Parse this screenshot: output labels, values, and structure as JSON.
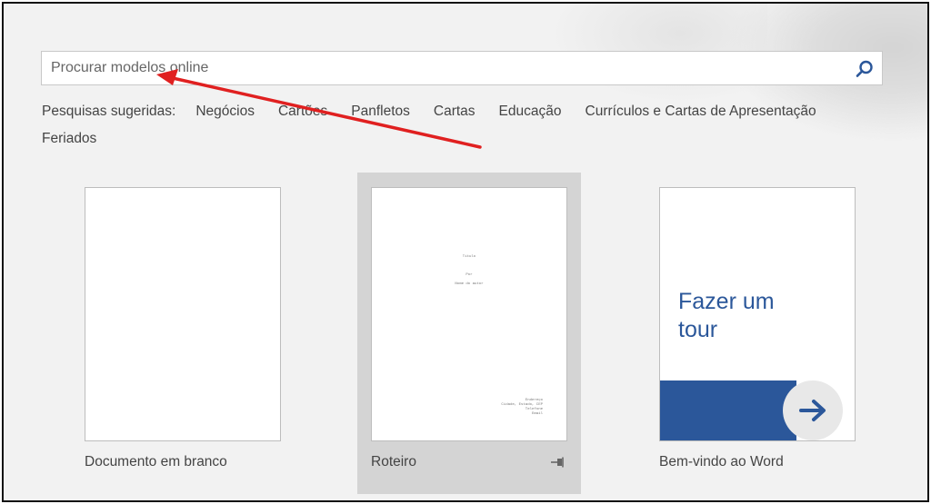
{
  "search": {
    "placeholder": "Procurar modelos online"
  },
  "suggestions": {
    "label": "Pesquisas sugeridas:",
    "items": [
      "Negócios",
      "Cartões",
      "Panfletos",
      "Cartas",
      "Educação",
      "Currículos e Cartas de Apresentação",
      "Feriados"
    ]
  },
  "templates": [
    {
      "label": "Documento em branco"
    },
    {
      "label": "Roteiro",
      "preview": {
        "title": "Título",
        "by": "Por",
        "author": "Nome do autor",
        "contact": [
          "Endereço",
          "Cidade, Estado, CEP",
          "Telefone",
          "Email"
        ]
      }
    },
    {
      "label": "Bem-vindo ao Word",
      "preview_text": "Fazer um tour"
    }
  ],
  "colors": {
    "accent": "#2b579a",
    "annotation_arrow": "#e02020"
  },
  "icons": {
    "search": "search-icon",
    "pin": "pin-icon",
    "tour_arrow": "arrow-right-icon"
  }
}
